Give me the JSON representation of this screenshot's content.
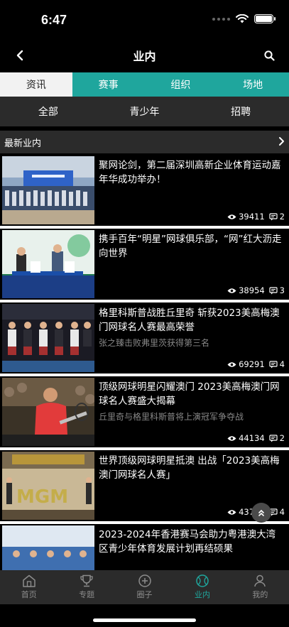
{
  "status": {
    "time": "6:47"
  },
  "nav": {
    "title": "业内"
  },
  "main_tabs": [
    {
      "label": "资讯",
      "active": true
    },
    {
      "label": "赛事",
      "active": false
    },
    {
      "label": "组织",
      "active": false
    },
    {
      "label": "场地",
      "active": false
    }
  ],
  "sub_tabs": [
    {
      "label": "全部"
    },
    {
      "label": "青少年"
    },
    {
      "label": "招聘"
    }
  ],
  "section": {
    "title": "最新业内"
  },
  "articles": [
    {
      "title": "聚网论剑，第二届深圳高新企业体育运动嘉年华成功举办！",
      "subtitle": "",
      "views": "39411",
      "comments": "2"
    },
    {
      "title": "携手百年“明星”网球俱乐部，“网”红大沥走向世界",
      "subtitle": "",
      "views": "38954",
      "comments": "3"
    },
    {
      "title": "格里科斯普战胜丘里奇 斩获2023美高梅澳门网球名人赛最高荣誉",
      "subtitle": "张之臻击败弗里茨获得第三名",
      "views": "69291",
      "comments": "4"
    },
    {
      "title": "顶级网球明星闪耀澳门 2023美高梅澳门网球名人赛盛大揭幕",
      "subtitle": "丘里奇与格里科斯普将上演冠军争夺战",
      "views": "44134",
      "comments": "2"
    },
    {
      "title": "世界顶级网球明星抵澳 出战「2023美高梅澳门网球名人赛」",
      "subtitle": "",
      "views": "43724",
      "comments": "4"
    },
    {
      "title": "2023-2024年香港赛马会助力粤港澳大湾区青少年体育发展计划再结硕果",
      "subtitle": "",
      "views": "",
      "comments": ""
    }
  ],
  "tab_bar": [
    {
      "label": "首页",
      "icon": "home-icon",
      "active": false
    },
    {
      "label": "专题",
      "icon": "trophy-icon",
      "active": false
    },
    {
      "label": "圈子",
      "icon": "plus-circle-icon",
      "active": false
    },
    {
      "label": "业内",
      "icon": "tennis-ball-icon",
      "active": true
    },
    {
      "label": "我的",
      "icon": "user-icon",
      "active": false
    }
  ],
  "colors": {
    "accent": "#1fa69d",
    "background": "#000000",
    "panel": "#2b2b2b"
  }
}
